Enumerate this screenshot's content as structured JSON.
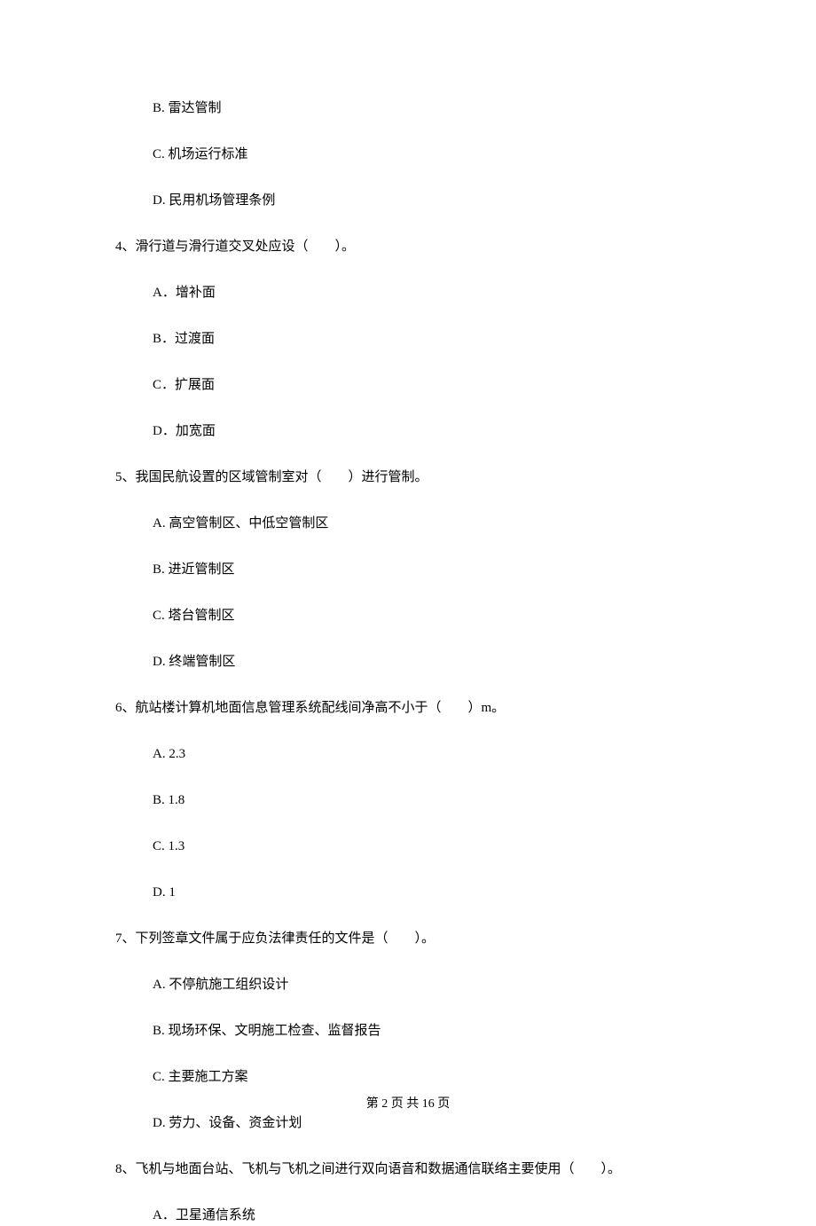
{
  "q3": {
    "options": {
      "b": "B.  雷达管制",
      "c": "C.  机场运行标准",
      "d": "D.  民用机场管理条例"
    }
  },
  "q4": {
    "text": "4、滑行道与滑行道交叉处应设（　　）。",
    "options": {
      "a": "A．增补面",
      "b": "B．过渡面",
      "c": "C．扩展面",
      "d": "D．加宽面"
    }
  },
  "q5": {
    "text": "5、我国民航设置的区域管制室对（　　）进行管制。",
    "options": {
      "a": "A.  高空管制区、中低空管制区",
      "b": "B.  进近管制区",
      "c": "C.  塔台管制区",
      "d": "D.  终端管制区"
    }
  },
  "q6": {
    "text": "6、航站楼计算机地面信息管理系统配线间净高不小于（　　）m。",
    "options": {
      "a": "A.  2.3",
      "b": "B.  1.8",
      "c": "C.  1.3",
      "d": "D.  1"
    }
  },
  "q7": {
    "text": "7、下列签章文件属于应负法律责任的文件是（　　）。",
    "options": {
      "a": "A.  不停航施工组织设计",
      "b": "B.  现场环保、文明施工检查、监督报告",
      "c": "C.  主要施工方案",
      "d": "D.  劳力、设备、资金计划"
    }
  },
  "q8": {
    "text": "8、飞机与地面台站、飞机与飞机之间进行双向语音和数据通信联络主要使用（　　）。",
    "options": {
      "a": "A．卫星通信系统"
    }
  },
  "footer": "第 2 页 共 16 页"
}
